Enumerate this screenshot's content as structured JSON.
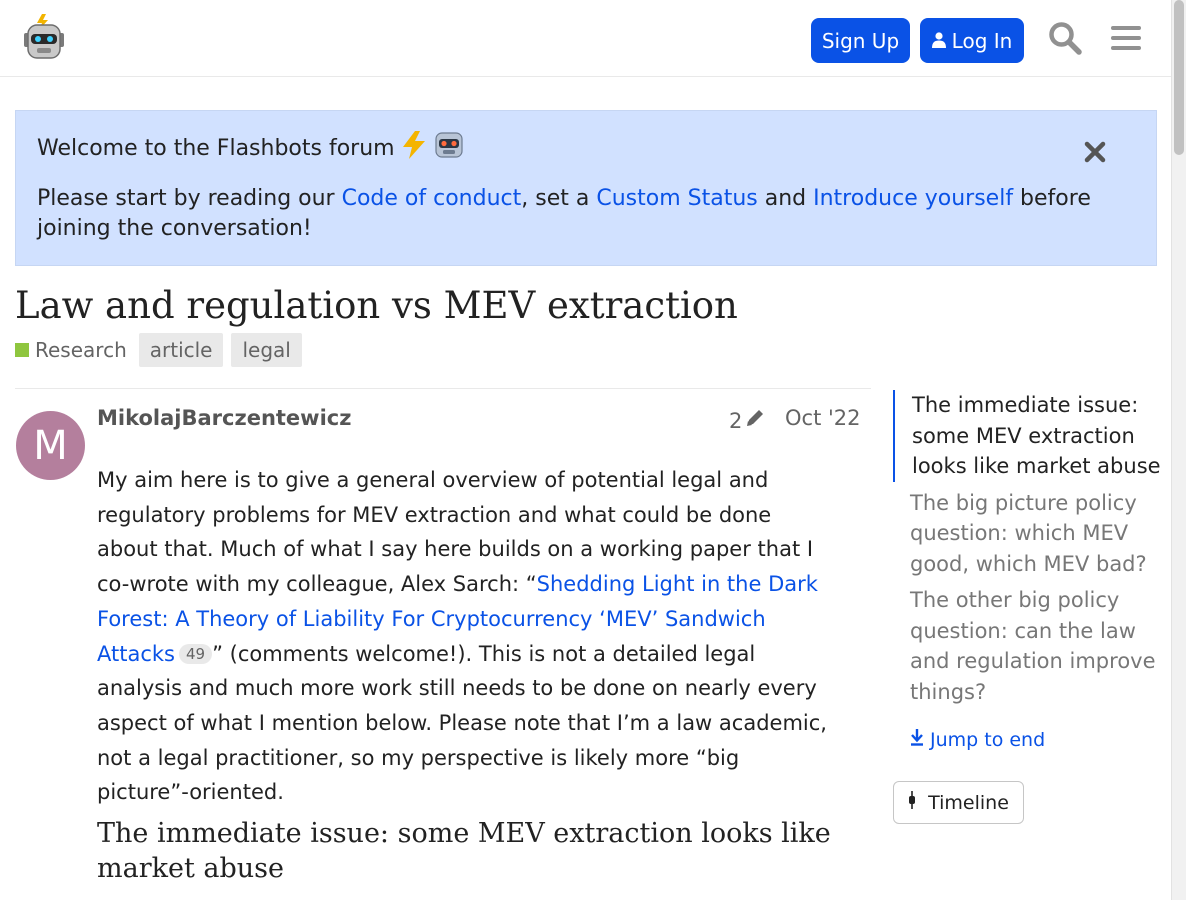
{
  "header": {
    "signup_label": "Sign Up",
    "login_label": "Log In",
    "icons": [
      "flashbots-robot-logo",
      "user-icon",
      "search-icon",
      "hamburger-menu-icon"
    ]
  },
  "banner": {
    "title": "Welcome to the Flashbots forum",
    "text_prefix": "Please start by reading our ",
    "link_conduct": "Code of conduct",
    "text_mid1": ", set a ",
    "link_status": "Custom Status",
    "text_mid2": " and ",
    "link_intro": "Introduce yourself",
    "text_suffix": " before joining the conversation!",
    "icons": [
      "lightning-icon",
      "robot-icon",
      "close-icon"
    ]
  },
  "topic": {
    "title": "Law and regulation vs MEV extraction",
    "category": "Research",
    "tags": [
      "article",
      "legal"
    ]
  },
  "post": {
    "avatar_letter": "M",
    "username": "MikolajBarczentewicz",
    "edit_count": "2",
    "date": "Oct '22",
    "body_before_link": "My aim here is to give a general overview of potential legal and regulatory problems for MEV extraction and what could be done about that. Much of what I say here builds on a working paper that I co-wrote with my colleague, Alex Sarch: “",
    "link_text": "Shedding Light in the Dark Forest: A Theory of Liability For Cryptocurrency ‘MEV’ Sandwich Attacks",
    "link_clicks": "49",
    "body_after_link": "” (comments welcome!). This is not a detailed legal analysis and much more work still needs to be done on nearly every aspect of what I mention below. Please note that I’m a law academic, not a legal practitioner, so my perspective is likely more “big picture”-oriented.",
    "heading": "The immediate issue: some MEV extraction looks like market abuse"
  },
  "toc": {
    "items": [
      "The immediate issue: some MEV extraction looks like market abuse",
      "The big picture policy question: which MEV good, which MEV bad?",
      "The other big policy question: can the law and regulation improve things?"
    ],
    "jump_label": "Jump to end",
    "timeline_label": "Timeline"
  },
  "colors": {
    "accent": "#0a52e6",
    "banner_bg": "#d1e1ff",
    "category": "#8fc63f",
    "avatar": "#b47f9d"
  }
}
